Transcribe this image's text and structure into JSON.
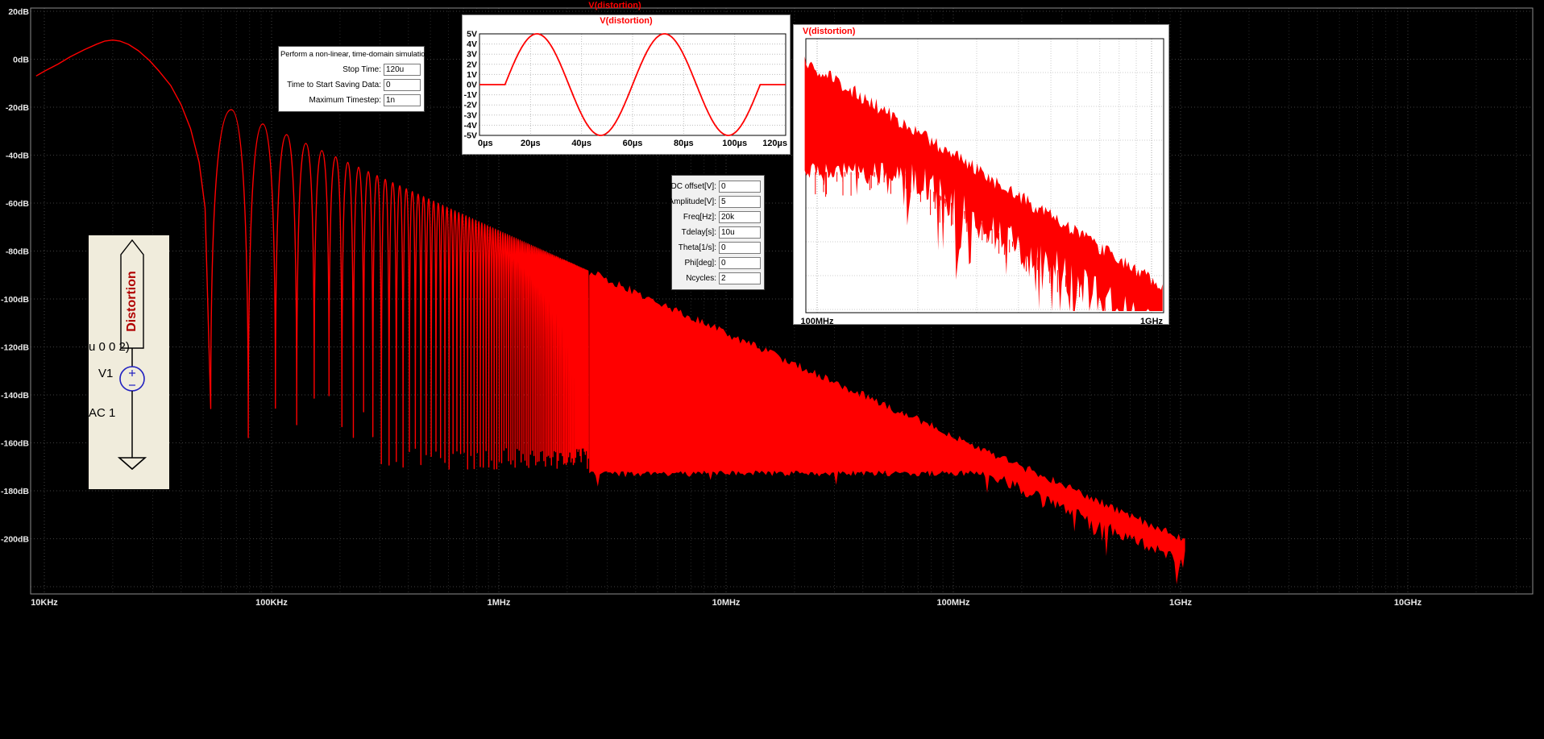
{
  "titles": {
    "main": "V(distortion)",
    "inset_time": "V(distortion)",
    "inset_hf": "V(distortion)"
  },
  "colors": {
    "trace": "#ff0000",
    "grid_major": "#3f3f3f",
    "grid_minor": "#292929",
    "plot_border": "#8c8c8c",
    "axis_text": "#e8e8e8",
    "inset_bg": "#ffffff",
    "inset_border": "#8a8a8a",
    "inset_grid_major": "#aaaaaa",
    "inset_grid_minor": "#cccccc",
    "inset_axis_text": "#000000",
    "schematic_bg": "#f0ecdc",
    "symbol_blue": "#2020c0",
    "net_label_red": "#b00000"
  },
  "chart_data": [
    {
      "id": "main-fft",
      "type": "line",
      "title": "V(distortion)",
      "x_scale": "log",
      "x_ticks": [
        {
          "label": "10KHz",
          "hz": 10000
        },
        {
          "label": "100KHz",
          "hz": 100000
        },
        {
          "label": "1MHz",
          "hz": 1000000
        },
        {
          "label": "10MHz",
          "hz": 10000000
        },
        {
          "label": "100MHz",
          "hz": 100000000
        },
        {
          "label": "1GHz",
          "hz": 1000000000
        },
        {
          "label": "10GHz",
          "hz": 10000000000
        }
      ],
      "y_ticks": [
        {
          "label": "20dB",
          "db": 20
        },
        {
          "label": "0dB",
          "db": 0
        },
        {
          "label": "-20dB",
          "db": -20
        },
        {
          "label": "-40dB",
          "db": -40
        },
        {
          "label": "-60dB",
          "db": -60
        },
        {
          "label": "-80dB",
          "db": -80
        },
        {
          "label": "-100dB",
          "db": -100
        },
        {
          "label": "-120dB",
          "db": -120
        },
        {
          "label": "-140dB",
          "db": -140
        },
        {
          "label": "-160dB",
          "db": -160
        },
        {
          "label": "-180dB",
          "db": -180
        },
        {
          "label": "-200dB",
          "db": -200
        }
      ],
      "trace": {
        "color": "#ff0000",
        "head": [
          [
            9200,
            -7
          ],
          [
            10000,
            -5
          ],
          [
            11500,
            -2
          ],
          [
            13000,
            1
          ],
          [
            15000,
            4
          ],
          [
            17000,
            6.3
          ],
          [
            18500,
            7.6
          ],
          [
            20000,
            8
          ],
          [
            21500,
            7.6
          ],
          [
            23500,
            6.2
          ],
          [
            26000,
            3.5
          ],
          [
            29000,
            -0.5
          ],
          [
            32000,
            -5
          ],
          [
            36000,
            -11
          ],
          [
            40000,
            -19
          ],
          [
            44000,
            -29
          ],
          [
            48000,
            -43
          ],
          [
            51000,
            -62
          ]
        ],
        "first_null_hz": 54000,
        "null_spacing_hz": 25000,
        "lobe_region_end_hz": 2500000,
        "envelope": {
          "ref_hz": 70000,
          "ref_db": -22,
          "slope_db_per_decade": -42.8
        },
        "noise_floor_db": -171.5,
        "end": {
          "hz": 1000000000,
          "db": -200
        }
      }
    },
    {
      "id": "time-domain",
      "type": "line",
      "title": "V(distortion)",
      "x_ticks": [
        {
          "label": "0µs",
          "us": 0
        },
        {
          "label": "20µs",
          "us": 20
        },
        {
          "label": "40µs",
          "us": 40
        },
        {
          "label": "60µs",
          "us": 60
        },
        {
          "label": "80µs",
          "us": 80
        },
        {
          "label": "100µs",
          "us": 100
        },
        {
          "label": "120µs",
          "us": 120
        }
      ],
      "y_ticks": [
        {
          "label": "5V",
          "v": 5
        },
        {
          "label": "4V",
          "v": 4
        },
        {
          "label": "3V",
          "v": 3
        },
        {
          "label": "2V",
          "v": 2
        },
        {
          "label": "1V",
          "v": 1
        },
        {
          "label": "0V",
          "v": 0
        },
        {
          "label": "-1V",
          "v": -1
        },
        {
          "label": "-2V",
          "v": -2
        },
        {
          "label": "-3V",
          "v": -3
        },
        {
          "label": "-4V",
          "v": -4
        },
        {
          "label": "-5V",
          "v": -5
        }
      ],
      "signal": {
        "type": "sine",
        "dc_v": 0,
        "amplitude_v": 5,
        "freq_hz": 20000,
        "tdelay_us": 10,
        "ncycles": 2
      },
      "color": "#ff0000"
    },
    {
      "id": "hf-fft",
      "type": "line",
      "title": "V(distortion)",
      "x_scale": "log",
      "x_ticks": [
        {
          "label": "100MHz",
          "hz": 100000000
        },
        {
          "label": "1GHz",
          "hz": 1000000000
        }
      ],
      "band": {
        "color": "#ff0000",
        "top_db_at_100mhz": -157,
        "top_db_at_1ghz": -200,
        "noise_floor_db": -176
      }
    }
  ],
  "dialogs": {
    "transient": {
      "title": "Perform a non-linear, time-domain simulation.",
      "fields": [
        {
          "label": "Stop Time:",
          "value": "120u"
        },
        {
          "label": "Time to Start Saving Data:",
          "value": "0"
        },
        {
          "label": "Maximum Timestep:",
          "value": "1n"
        }
      ]
    },
    "sine": {
      "fields": [
        {
          "label": "DC offset[V]:",
          "value": "0"
        },
        {
          "label": "Amplitude[V]:",
          "value": "5"
        },
        {
          "label": "Freq[Hz]:",
          "value": "20k"
        },
        {
          "label": "Tdelay[s]:",
          "value": "10u"
        },
        {
          "label": "Theta[1/s]:",
          "value": "0"
        },
        {
          "label": "Phi[deg]:",
          "value": "0"
        },
        {
          "label": "Ncycles:",
          "value": "2"
        }
      ]
    }
  },
  "schematic": {
    "net_label": "Distortion",
    "clipped_text": "u 0 0 2)",
    "designator": "V1",
    "directive": "AC 1"
  }
}
